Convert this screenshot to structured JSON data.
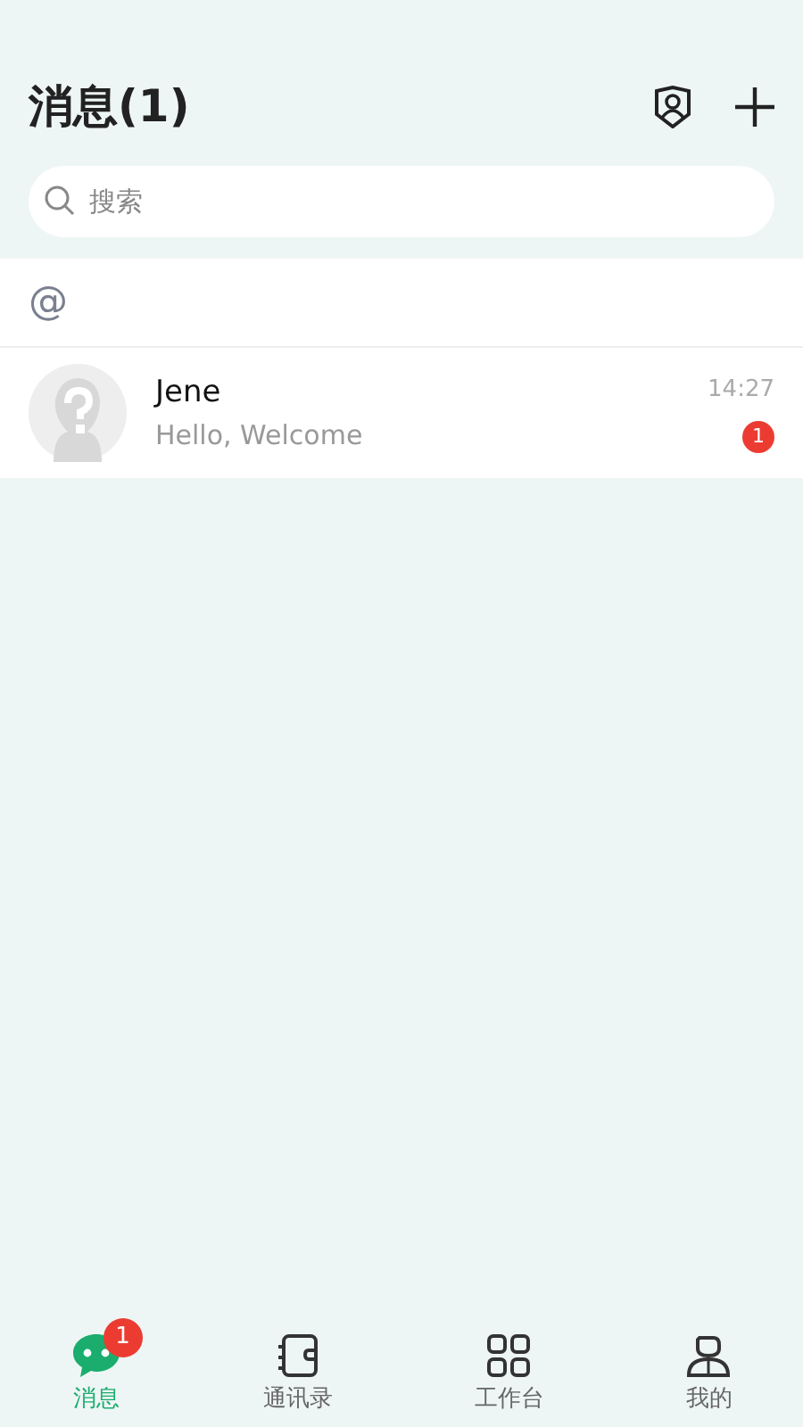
{
  "header": {
    "title": "消息(1)"
  },
  "search": {
    "placeholder": "搜索"
  },
  "mention_row": {
    "symbol": "@"
  },
  "conversations": [
    {
      "name": "Jene",
      "preview": "Hello, Welcome",
      "time": "14:27",
      "unread": "1"
    }
  ],
  "tabs": [
    {
      "kind": "chat",
      "label": "消息",
      "selected": true,
      "badge": "1"
    },
    {
      "kind": "contacts",
      "label": "通讯录",
      "selected": false
    },
    {
      "kind": "apps",
      "label": "工作台",
      "selected": false
    },
    {
      "kind": "me",
      "label": "我的",
      "selected": false
    }
  ]
}
